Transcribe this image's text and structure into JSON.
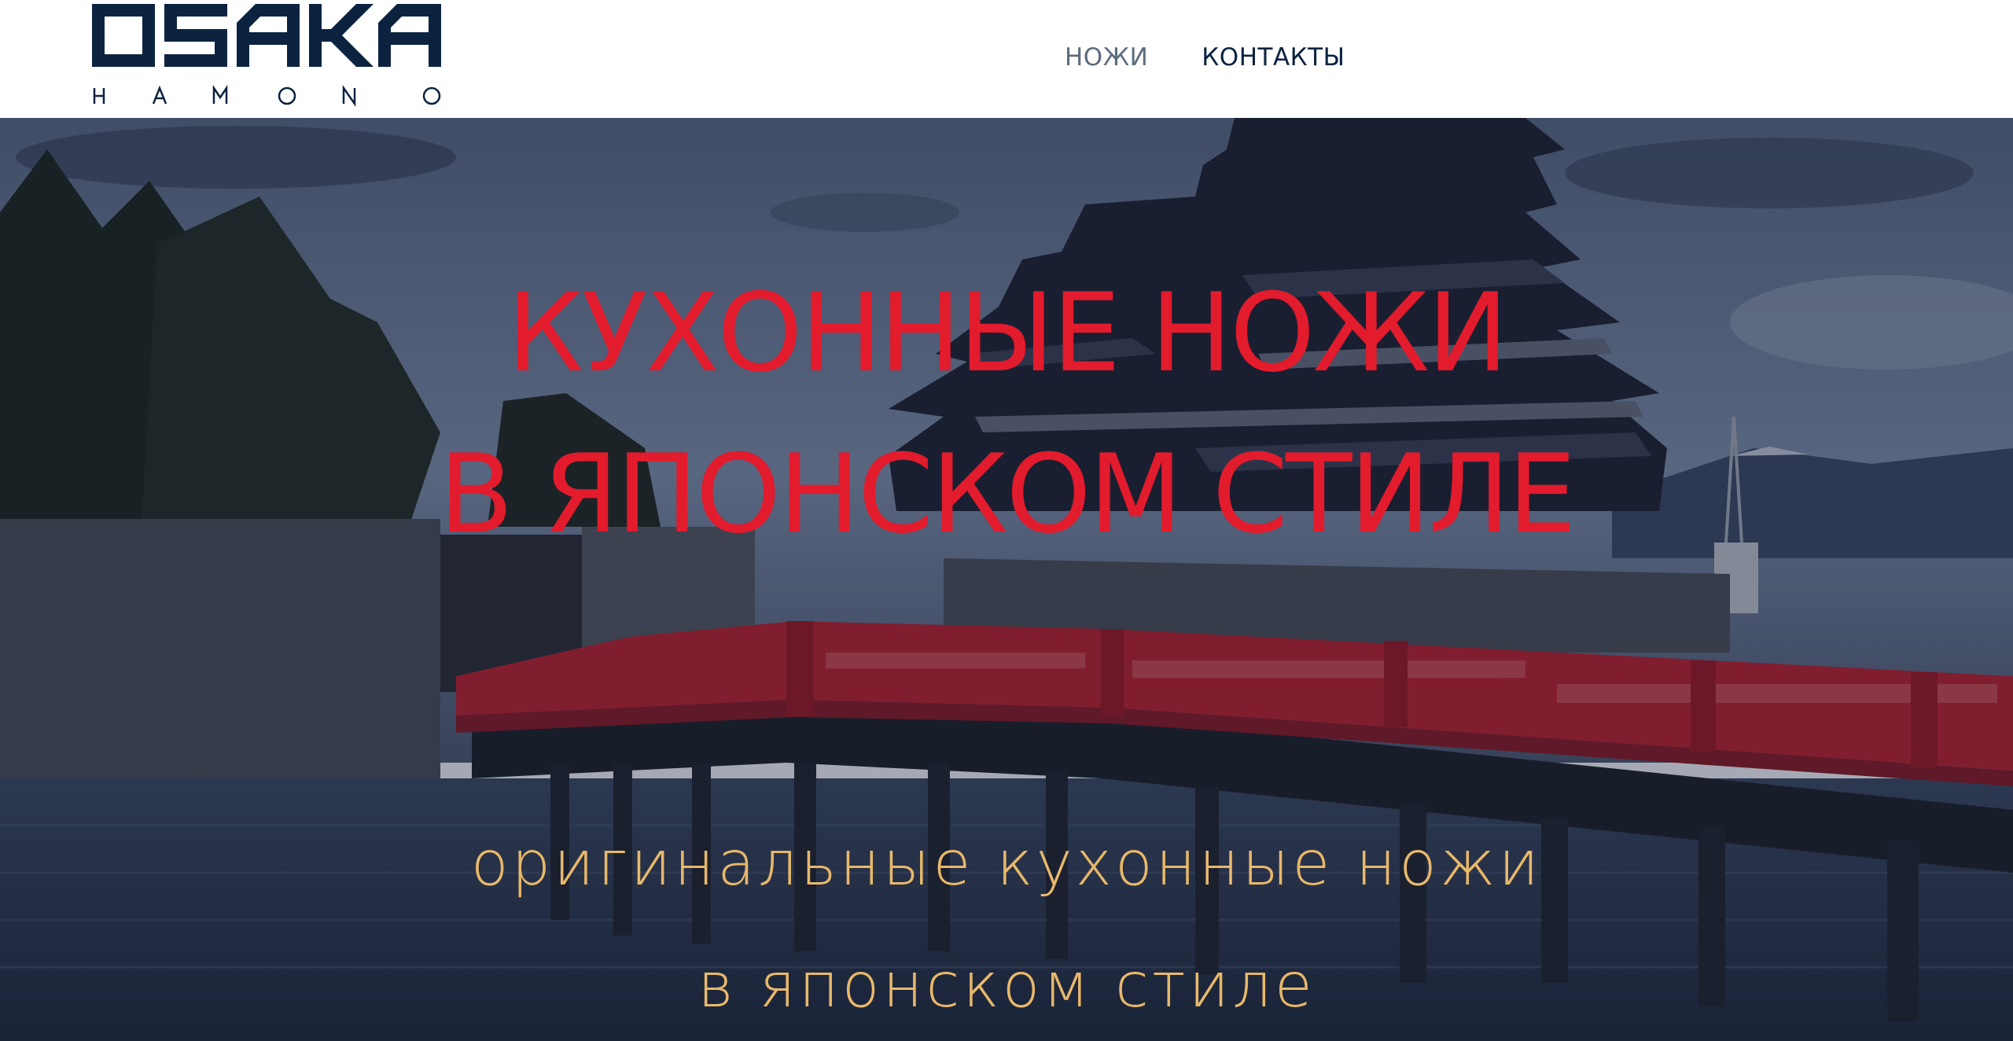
{
  "header": {
    "logo": {
      "main": "OSAKA",
      "sub": "HAMONO"
    },
    "nav": [
      {
        "label": "НОЖИ"
      },
      {
        "label": "КОНТАКТЫ"
      }
    ]
  },
  "hero": {
    "title_line1": "КУХОННЫЕ НОЖИ",
    "title_line2": "В ЯПОНСКОМ СТИЛЕ",
    "subtitle_line1": "оригинальные кухонные ножи",
    "subtitle_line2": "в японском стиле"
  },
  "colors": {
    "brand_navy": "#0c2340",
    "nav_muted": "#5b6b7d",
    "title_red": "#e21b2d",
    "subtitle_gold": "#e8b86a",
    "bridge_red": "#c21f2a"
  }
}
